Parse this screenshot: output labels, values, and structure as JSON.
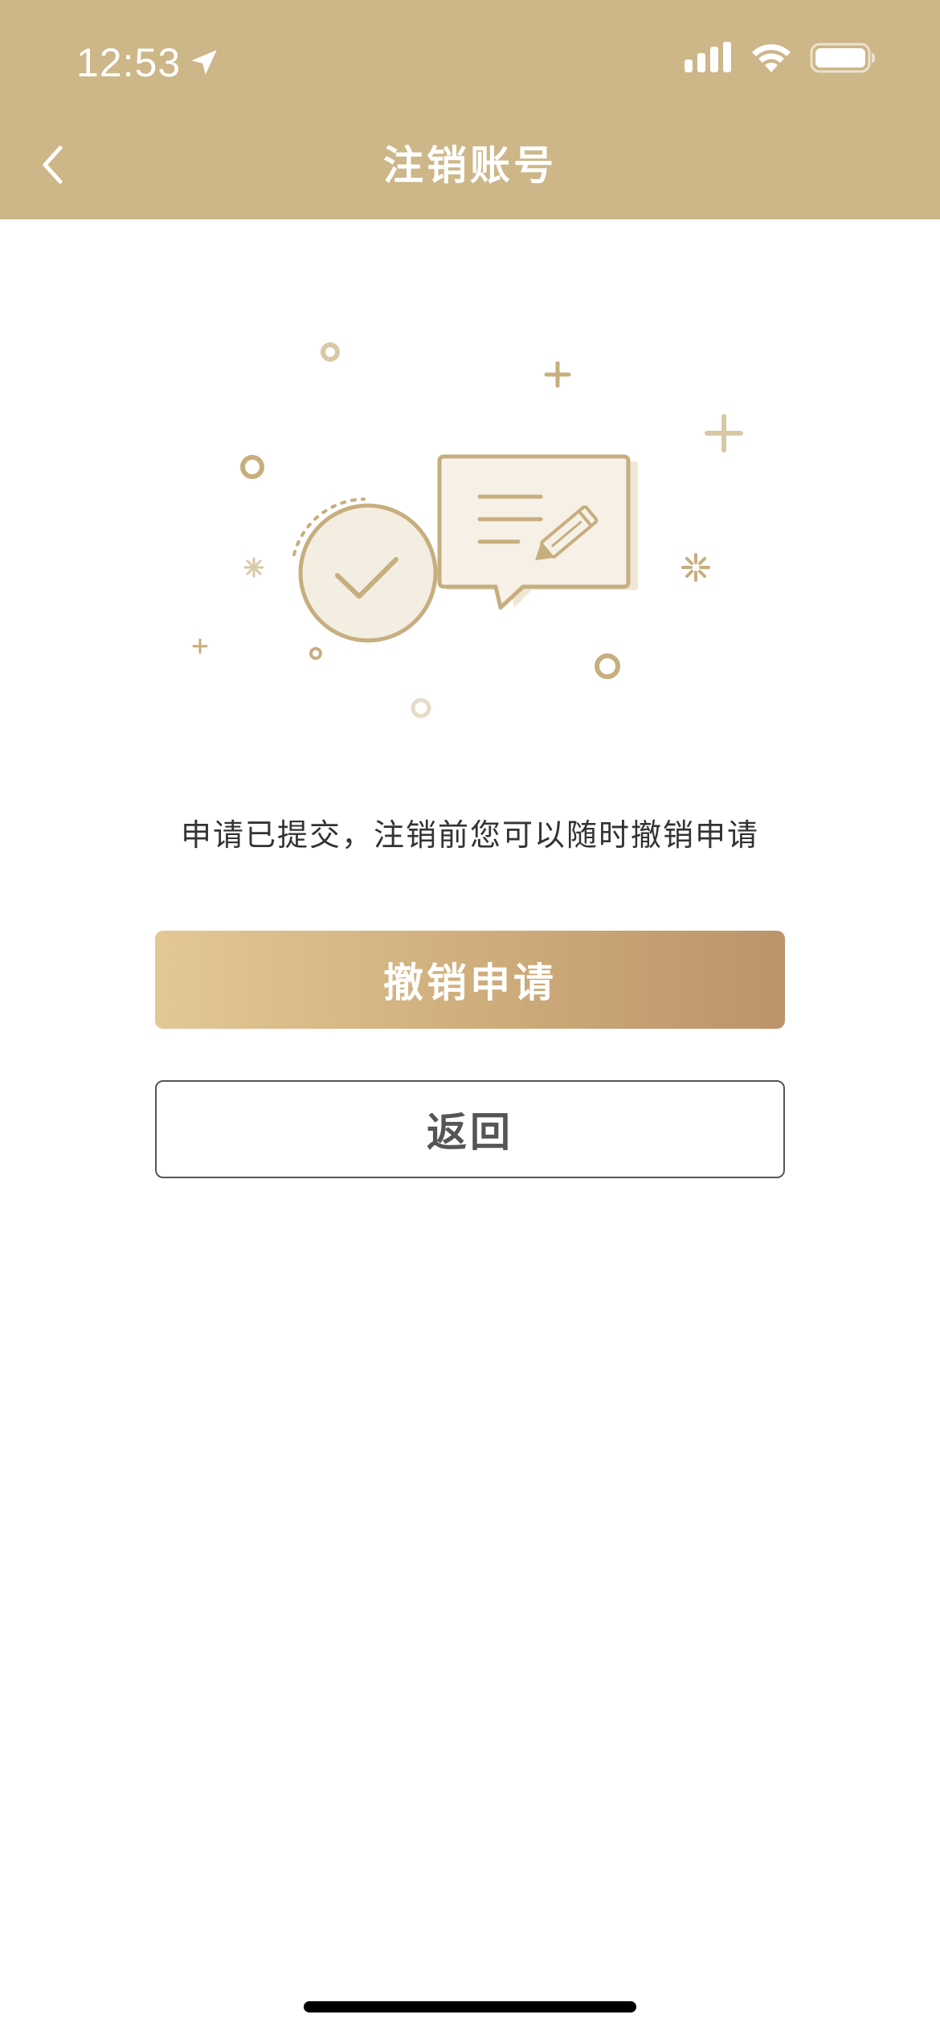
{
  "status_bar": {
    "time": "12:53",
    "location_icon": "location-arrow-icon",
    "signal_icon": "cellular-signal-icon",
    "wifi_icon": "wifi-icon",
    "battery_icon": "battery-icon"
  },
  "nav": {
    "title": "注销账号",
    "back_icon": "chevron-left-icon"
  },
  "illustration": {
    "icon": "submitted-check-message-icon"
  },
  "content": {
    "message": "申请已提交，注销前您可以随时撤销申请"
  },
  "actions": {
    "revoke_label": "撤销申请",
    "back_label": "返回"
  },
  "colors": {
    "header_bg": "#CDB688",
    "accent_gold": "#C7AE7E",
    "button_gradient_start": "#E3C796",
    "button_gradient_end": "#BD936B",
    "text_dark": "#333333",
    "outline_button": "#555555"
  }
}
